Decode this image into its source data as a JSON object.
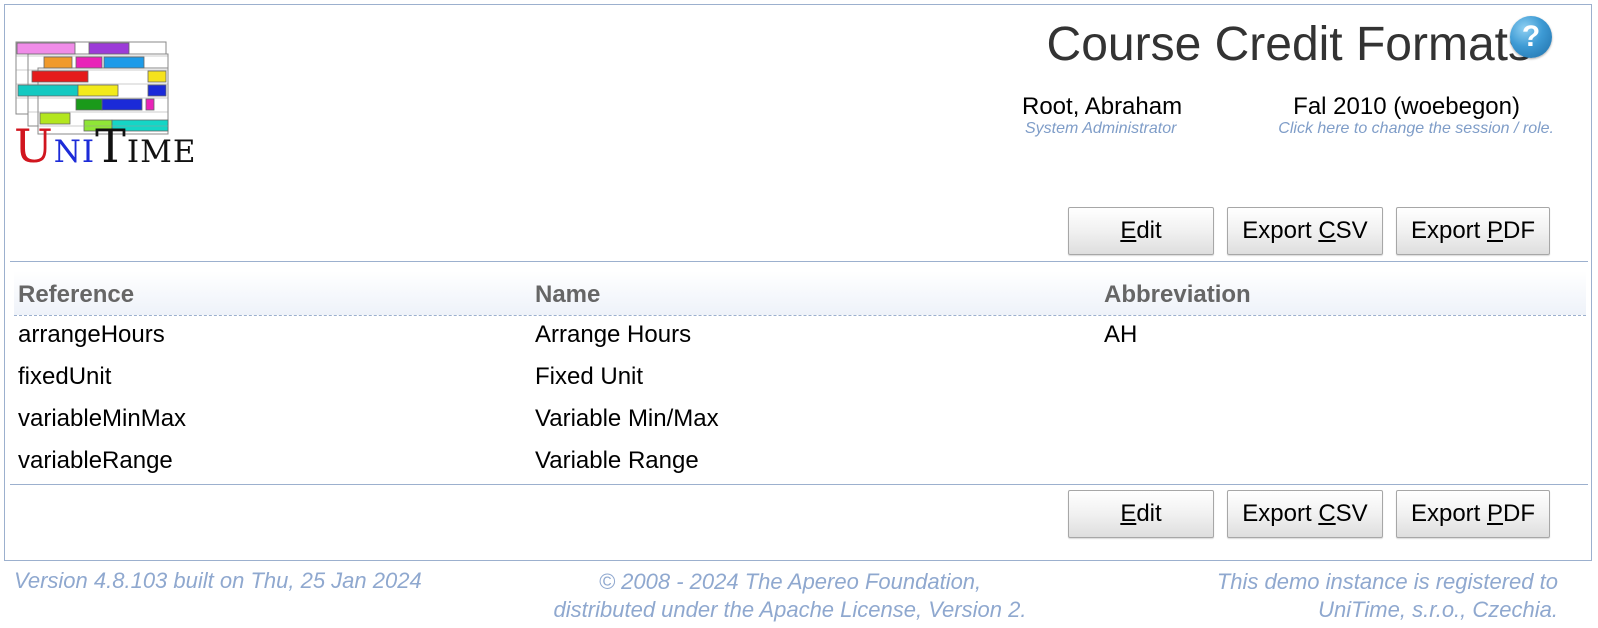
{
  "header": {
    "title": "Course Credit Formats",
    "help_icon": "question-mark-icon",
    "user": {
      "name": "Root, Abraham",
      "role": "System Administrator"
    },
    "session": {
      "name": "Fal 2010 (woebegon)",
      "hint": "Click here to change the session / role."
    }
  },
  "logo": {
    "word_u": "U",
    "word_ni": "NI",
    "word_t": "T",
    "word_ime": "IME"
  },
  "toolbar_top": {
    "edit": {
      "mnemonic": "E",
      "rest": "dit"
    },
    "export_csv": {
      "pre": "Export ",
      "mnemonic": "C",
      "rest": "SV"
    },
    "export_pdf": {
      "pre": "Export ",
      "mnemonic": "P",
      "rest": "DF"
    }
  },
  "toolbar_bottom": {
    "edit": {
      "mnemonic": "E",
      "rest": "dit"
    },
    "export_csv": {
      "pre": "Export ",
      "mnemonic": "C",
      "rest": "SV"
    },
    "export_pdf": {
      "pre": "Export ",
      "mnemonic": "P",
      "rest": "DF"
    }
  },
  "table": {
    "columns": [
      "Reference",
      "Name",
      "Abbreviation"
    ],
    "rows": [
      {
        "reference": "arrangeHours",
        "name": "Arrange Hours",
        "abbreviation": "AH"
      },
      {
        "reference": "fixedUnit",
        "name": "Fixed Unit",
        "abbreviation": ""
      },
      {
        "reference": "variableMinMax",
        "name": "Variable Min/Max",
        "abbreviation": ""
      },
      {
        "reference": "variableRange",
        "name": "Variable Range",
        "abbreviation": ""
      }
    ]
  },
  "footer": {
    "version": "Version 4.8.103 built on Thu, 25 Jan 2024",
    "copyright_line1": "© 2008 - 2024 The Apereo Foundation,",
    "copyright_line2": "distributed under the Apache License, Version 2.",
    "registration_line1": "This demo instance is registered to",
    "registration_line2": "UniTime, s.r.o., Czechia."
  },
  "colors": {
    "border": "#9cb0ce",
    "hint_text": "#7f9dc8",
    "footer_text": "#8fa8cf",
    "header_text": "#666666",
    "help_icon": "#3d9ad4"
  }
}
